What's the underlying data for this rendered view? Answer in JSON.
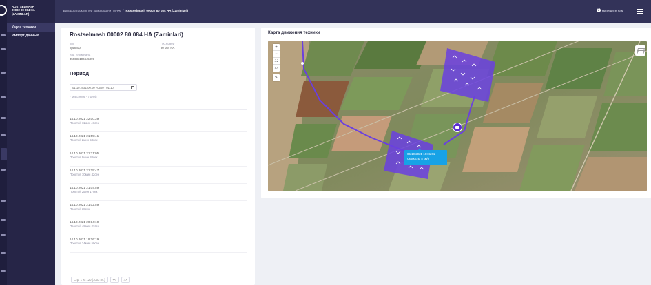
{
  "sidebar": {
    "title_lines": [
      "ROSTSELMASH",
      "00002 80 084 HA",
      "(ZAMINLAR)"
    ],
    "items": [
      {
        "label": "Карта техники",
        "active": true
      },
      {
        "label": "Импорт данных",
        "active": false
      }
    ]
  },
  "topbar": {
    "breadcrumb_root": "\"Бризро агроклистер замохладни\" МЧЖ",
    "breadcrumb_sep": "/",
    "breadcrumb_current": "Rostselmash 00002 80 084 HA (Zaminlari)",
    "help_label": "Напишите нам",
    "help_icon": "question-icon",
    "menu_icon": "hamburger-icon"
  },
  "vehicle": {
    "title": "Rostselmash 00002 80 084 HA (Zaminlari)",
    "fields": [
      {
        "key": "Тип",
        "value": "Трактор"
      },
      {
        "key": "Гос.номер",
        "value": "80 084 HA"
      },
      {
        "key": "Код терминала",
        "value": "359633100445399"
      }
    ]
  },
  "period": {
    "title": "Период",
    "range_value": "01.10.2021 00:00 +0500 - 01.10.",
    "hint": "* Максимум - 7 дней",
    "calendar_icon": "calendar-icon"
  },
  "events": [
    {
      "time": "14.10.2021 22:00:39",
      "desc": "Простой 11мин 47сек"
    },
    {
      "time": "14.10.2021 21:55:41",
      "desc": "Простой 2мин 58сек"
    },
    {
      "time": "14.10.2021 21:31:05",
      "desc": "Простой 9мин 20сек"
    },
    {
      "time": "14.10.2021 21:15:47",
      "desc": "Простой 10мин 42сек"
    },
    {
      "time": "14.10.2021 21:04:59",
      "desc": "Простой 2мин 17сек"
    },
    {
      "time": "14.10.2021 21:02:59",
      "desc": "Простой 38сек"
    },
    {
      "time": "14.10.2021 20:14:10",
      "desc": "Простой 49мин 27сек"
    },
    {
      "time": "14.10.2021 19:16:19",
      "desc": "Простой 24мин 50сек"
    }
  ],
  "pager": {
    "info": "Стр. 1 из 120 (1003 эл.)",
    "prev": "<<",
    "next": ">>"
  },
  "map": {
    "title": "Карта движения техники",
    "zoom_in": "+",
    "zoom_out": "−",
    "fullscreen_icon": "fullscreen-icon",
    "ruler_icon": "ruler-icon",
    "layers_icon": "layers-icon",
    "vehicle_marker_icon": "tractor-icon",
    "tooltip_time": "05.10.2021 16:01:01",
    "tooltip_speed": "Скорость: 8 км/ч",
    "route_color": "#6a3fe0"
  }
}
